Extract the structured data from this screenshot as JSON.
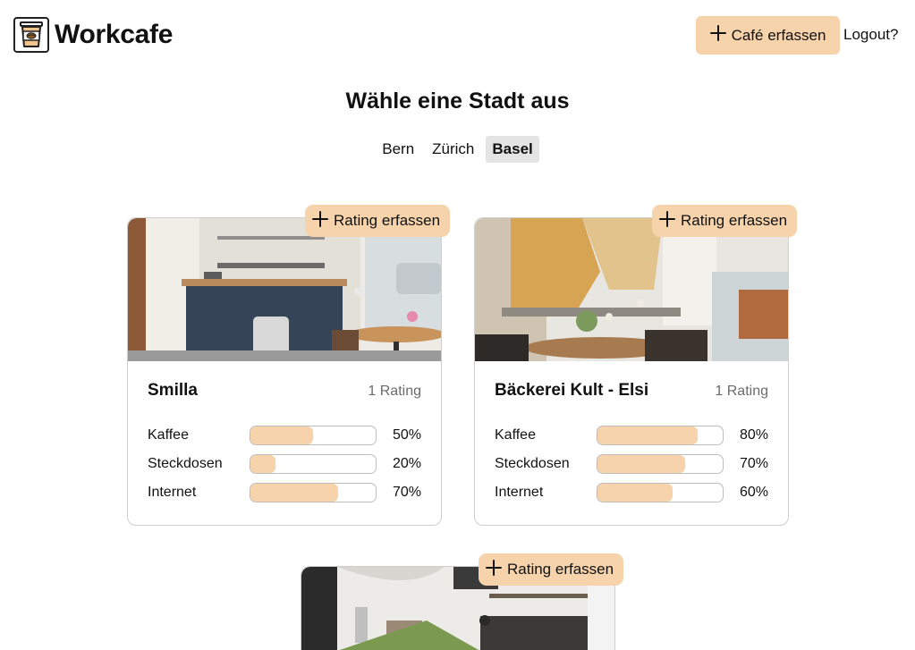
{
  "header": {
    "brand": "Workcafe",
    "add_cafe_label": "Café erfassen",
    "logout_label": "Logout?"
  },
  "main": {
    "title": "Wähle eine Stadt aus",
    "cities": [
      {
        "label": "Bern",
        "active": false
      },
      {
        "label": "Zürich",
        "active": false
      },
      {
        "label": "Basel",
        "active": true
      }
    ]
  },
  "rate_label": "Rating erfassen",
  "cafes": [
    {
      "name": "Smilla",
      "ratings": "1 Rating",
      "metrics": [
        {
          "label": "Kaffee",
          "value": 50,
          "text": "50%"
        },
        {
          "label": "Steckdosen",
          "value": 20,
          "text": "20%"
        },
        {
          "label": "Internet",
          "value": 70,
          "text": "70%"
        }
      ]
    },
    {
      "name": "Bäckerei Kult - Elsi",
      "ratings": "1 Rating",
      "metrics": [
        {
          "label": "Kaffee",
          "value": 80,
          "text": "80%"
        },
        {
          "label": "Steckdosen",
          "value": 70,
          "text": "70%"
        },
        {
          "label": "Internet",
          "value": 60,
          "text": "60%"
        }
      ]
    }
  ],
  "colors": {
    "accent": "#f6d3ab",
    "border": "#cfcfcf",
    "muted_text": "#6b6b6b"
  }
}
